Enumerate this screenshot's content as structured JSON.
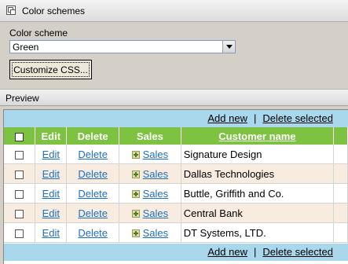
{
  "window": {
    "title": "Color schemes"
  },
  "form": {
    "scheme_label": "Color scheme",
    "scheme_value": "Green",
    "customize_label": "Customize CSS..."
  },
  "preview": {
    "label": "Preview"
  },
  "grid": {
    "add_new": "Add new",
    "separator": "|",
    "delete_selected": "Delete selected",
    "columns": {
      "edit": "Edit",
      "delete": "Delete",
      "sales": "Sales",
      "customer": "Customer name"
    },
    "rows": [
      {
        "edit": "Edit",
        "delete": "Delete",
        "sales": "Sales",
        "name": "Signature Design"
      },
      {
        "edit": "Edit",
        "delete": "Delete",
        "sales": "Sales",
        "name": "Dallas Technologies"
      },
      {
        "edit": "Edit",
        "delete": "Delete",
        "sales": "Sales",
        "name": "Buttle, Griffith and Co."
      },
      {
        "edit": "Edit",
        "delete": "Delete",
        "sales": "Sales",
        "name": "Central Bank"
      },
      {
        "edit": "Edit",
        "delete": "Delete",
        "sales": "Sales",
        "name": "DT Systems, LTD."
      }
    ]
  },
  "colors": {
    "header": "#7dc241",
    "pager": "#a9d8ec",
    "alt_row": "#f8ece0",
    "link": "#1f6fbf"
  }
}
